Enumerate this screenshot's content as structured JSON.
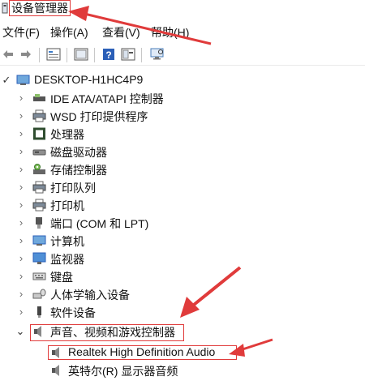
{
  "window": {
    "title": "设备管理器"
  },
  "menu": [
    "文件(F)",
    "操作(A)",
    "查看(V)",
    "帮助(H)"
  ],
  "toolbar": {
    "icons": [
      "back-icon",
      "forward-icon",
      "properties-icon",
      "view-icon",
      "help-icon",
      "show-hidden-icon",
      "scan-hardware-icon"
    ]
  },
  "tree": {
    "root": "DESKTOP-H1HC4P9",
    "categories": [
      {
        "label": "IDE ATA/ATAPI 控制器",
        "icon": "ide-controller-icon"
      },
      {
        "label": "WSD 打印提供程序",
        "icon": "printer-icon"
      },
      {
        "label": "处理器",
        "icon": "processor-icon"
      },
      {
        "label": "磁盘驱动器",
        "icon": "disk-drive-icon"
      },
      {
        "label": "存储控制器",
        "icon": "storage-controller-icon"
      },
      {
        "label": "打印队列",
        "icon": "print-queue-icon"
      },
      {
        "label": "打印机",
        "icon": "printer-icon"
      },
      {
        "label": "端口 (COM 和 LPT)",
        "icon": "port-icon"
      },
      {
        "label": "计算机",
        "icon": "computer-icon"
      },
      {
        "label": "监视器",
        "icon": "monitor-icon"
      },
      {
        "label": "键盘",
        "icon": "keyboard-icon"
      },
      {
        "label": "人体学输入设备",
        "icon": "hid-icon"
      },
      {
        "label": "软件设备",
        "icon": "software-device-icon"
      },
      {
        "label": "声音、视频和游戏控制器",
        "icon": "speaker-icon",
        "expanded": true,
        "children": [
          {
            "label": "Realtek High Definition Audio",
            "icon": "speaker-icon"
          },
          {
            "label": "英特尔(R) 显示器音频",
            "icon": "speaker-icon"
          }
        ]
      }
    ]
  },
  "colors": {
    "annotation": "#e03b3b",
    "tree_arrow": "#6a6a6a",
    "blue": "#2b79d0"
  }
}
